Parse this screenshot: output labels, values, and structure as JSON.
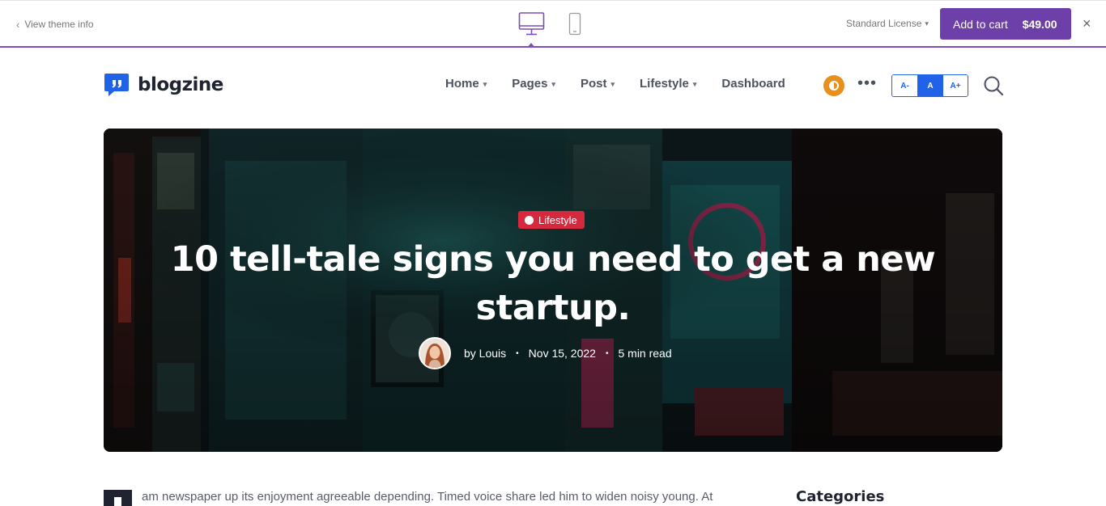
{
  "preview_bar": {
    "back_label": "View theme info",
    "license_label": "Standard License",
    "cart_label": "Add to cart",
    "cart_price": "$49.00",
    "close_symbol": "×",
    "accent_color": "#6d3fa8"
  },
  "header": {
    "logo_text": "blogzine",
    "nav": [
      {
        "label": "Home",
        "dropdown": true
      },
      {
        "label": "Pages",
        "dropdown": true
      },
      {
        "label": "Post",
        "dropdown": true
      },
      {
        "label": "Lifestyle",
        "dropdown": true
      },
      {
        "label": "Dashboard",
        "dropdown": false
      }
    ],
    "font_sizes": [
      {
        "label": "A-",
        "active": false
      },
      {
        "label": "A",
        "active": true
      },
      {
        "label": "A+",
        "active": false
      }
    ],
    "primary_color": "#2163e8"
  },
  "hero": {
    "category": "Lifestyle",
    "category_color": "#d6293e",
    "title_line1": "10 tell-tale signs you need to get a new",
    "title_line2": "startup.",
    "author": "by Louis",
    "date": "Nov 15, 2022",
    "read_time": "5 min read"
  },
  "article": {
    "first_line": "am newspaper up its enjoyment agreeable depending. Timed voice share led him to widen noisy young. At"
  },
  "sidebar": {
    "categories_title": "Categories"
  }
}
